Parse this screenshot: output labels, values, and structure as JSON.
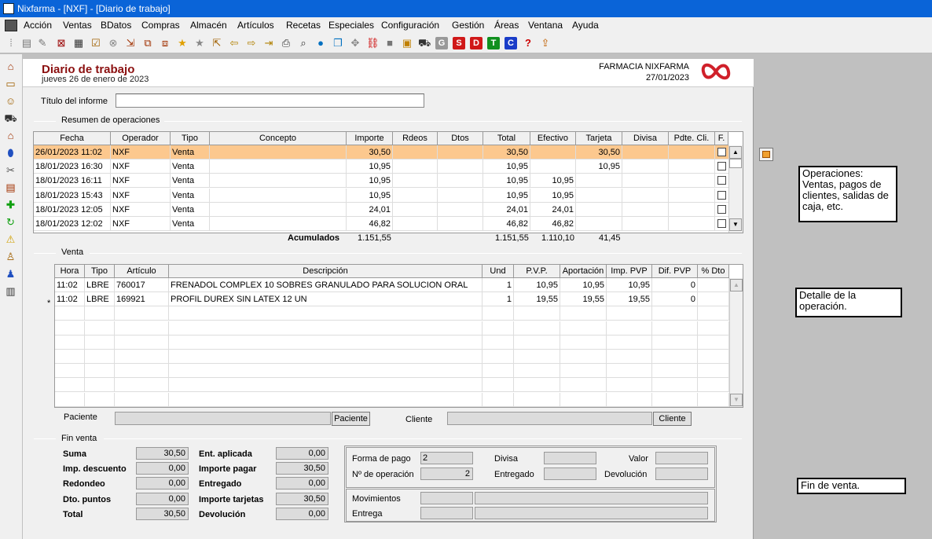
{
  "window": {
    "title": "Nixfarma - [NXF] - [Diario de trabajo]"
  },
  "menu": [
    "Acción",
    "Ventas",
    "BDatos",
    "Compras",
    "Almacén",
    "Artículos",
    "Recetas",
    "Especiales",
    "Configuración",
    "Gestión",
    "Áreas",
    "Ventana",
    "Ayuda"
  ],
  "toolbar_letters": {
    "g": "G",
    "s": "S",
    "d": "D",
    "t": "T",
    "c": "C",
    "help": "?"
  },
  "header": {
    "title": "Diario de trabajo",
    "date": "jueves 26 de enero de 2023",
    "pharmacy": "FARMACIA NIXFARMA",
    "pharmacy_date": "27/01/2023"
  },
  "report": {
    "title_label": "Título del informe",
    "title_value": ""
  },
  "summary": {
    "section": "Resumen de operaciones",
    "columns": [
      "Fecha",
      "Operador",
      "Tipo",
      "Concepto",
      "Importe",
      "Rdeos",
      "Dtos",
      "Total",
      "Efectivo",
      "Tarjeta",
      "Divisa",
      "Pdte. Cli.",
      "F."
    ],
    "rows": [
      [
        "26/01/2023 11:02",
        "NXF",
        "Venta",
        "",
        "30,50",
        "",
        "",
        "30,50",
        "",
        "30,50",
        "",
        ""
      ],
      [
        "18/01/2023 16:30",
        "NXF",
        "Venta",
        "",
        "10,95",
        "",
        "",
        "10,95",
        "",
        "10,95",
        "",
        ""
      ],
      [
        "18/01/2023 16:11",
        "NXF",
        "Venta",
        "",
        "10,95",
        "",
        "",
        "10,95",
        "10,95",
        "",
        "",
        ""
      ],
      [
        "18/01/2023 15:43",
        "NXF",
        "Venta",
        "",
        "10,95",
        "",
        "",
        "10,95",
        "10,95",
        "",
        "",
        ""
      ],
      [
        "18/01/2023 12:05",
        "NXF",
        "Venta",
        "",
        "24,01",
        "",
        "",
        "24,01",
        "24,01",
        "",
        "",
        ""
      ],
      [
        "18/01/2023 12:02",
        "NXF",
        "Venta",
        "",
        "46,82",
        "",
        "",
        "46,82",
        "46,82",
        "",
        "",
        ""
      ]
    ],
    "totals": {
      "label": "Acumulados",
      "importe": "1.151,55",
      "total": "1.151,55",
      "efectivo": "1.110,10",
      "tarjeta": "41,45"
    }
  },
  "sale": {
    "section": "Venta",
    "columns": [
      "Hora",
      "Tipo",
      "Artículo",
      "Descripción",
      "Und",
      "P.V.P.",
      "Aportación",
      "Imp. PVP",
      "Dif. PVP",
      "% Dto"
    ],
    "rows": [
      {
        "marker": "",
        "cells": [
          "11:02",
          "LBRE",
          "760017",
          "FRENADOL COMPLEX 10 SOBRES GRANULADO PARA SOLUCION ORAL",
          "1",
          "10,95",
          "10,95",
          "10,95",
          "0",
          ""
        ]
      },
      {
        "marker": "*",
        "cells": [
          "11:02",
          "LBRE",
          "169921",
          "PROFIL DUREX SIN LATEX 12 UN",
          "1",
          "19,55",
          "19,55",
          "19,55",
          "0",
          ""
        ]
      }
    ],
    "paciente_label": "Paciente",
    "paciente_button": "Paciente",
    "cliente_label": "Cliente",
    "cliente_button": "Cliente"
  },
  "fin_venta": {
    "section": "Fin venta",
    "suma_label": "Suma",
    "suma": "30,50",
    "imp_descuento_label": "Imp. descuento",
    "imp_descuento": "0,00",
    "redondeo_label": "Redondeo",
    "redondeo": "0,00",
    "dto_puntos_label": "Dto. puntos",
    "dto_puntos": "0,00",
    "total_label": "Total",
    "total": "30,50",
    "ent_aplicada_label": "Ent. aplicada",
    "ent_aplicada": "0,00",
    "importe_pagar_label": "Importe pagar",
    "importe_pagar": "30,50",
    "entregado_label": "Entregado",
    "entregado": "0,00",
    "importe_tarjetas_label": "Importe tarjetas",
    "importe_tarjetas": "30,50",
    "devolucion_label": "Devolución",
    "devolucion": "0,00",
    "forma_pago_label": "Forma de pago",
    "forma_pago": "2",
    "num_operacion_label": "Nº de operación",
    "num_operacion": "2",
    "divisa_label": "Divisa",
    "divisa": "",
    "entregado2_label": "Entregado",
    "entregado2": "",
    "valor_label": "Valor",
    "valor": "",
    "devolucion2_label": "Devolución",
    "devolucion2": "",
    "movimientos_label": "Movimientos",
    "entrega_label": "Entrega"
  },
  "notes": {
    "operaciones": "Operaciones: Ventas, pagos de clientes, salidas de caja, etc.",
    "detalle": "Detalle de la operación.",
    "fin": "Fin de venta."
  },
  "colors": {
    "title_bar": "#0a64d8",
    "selected_row": "#fcc88e",
    "header_title": "#8b1010",
    "logo": "#d0202a"
  }
}
